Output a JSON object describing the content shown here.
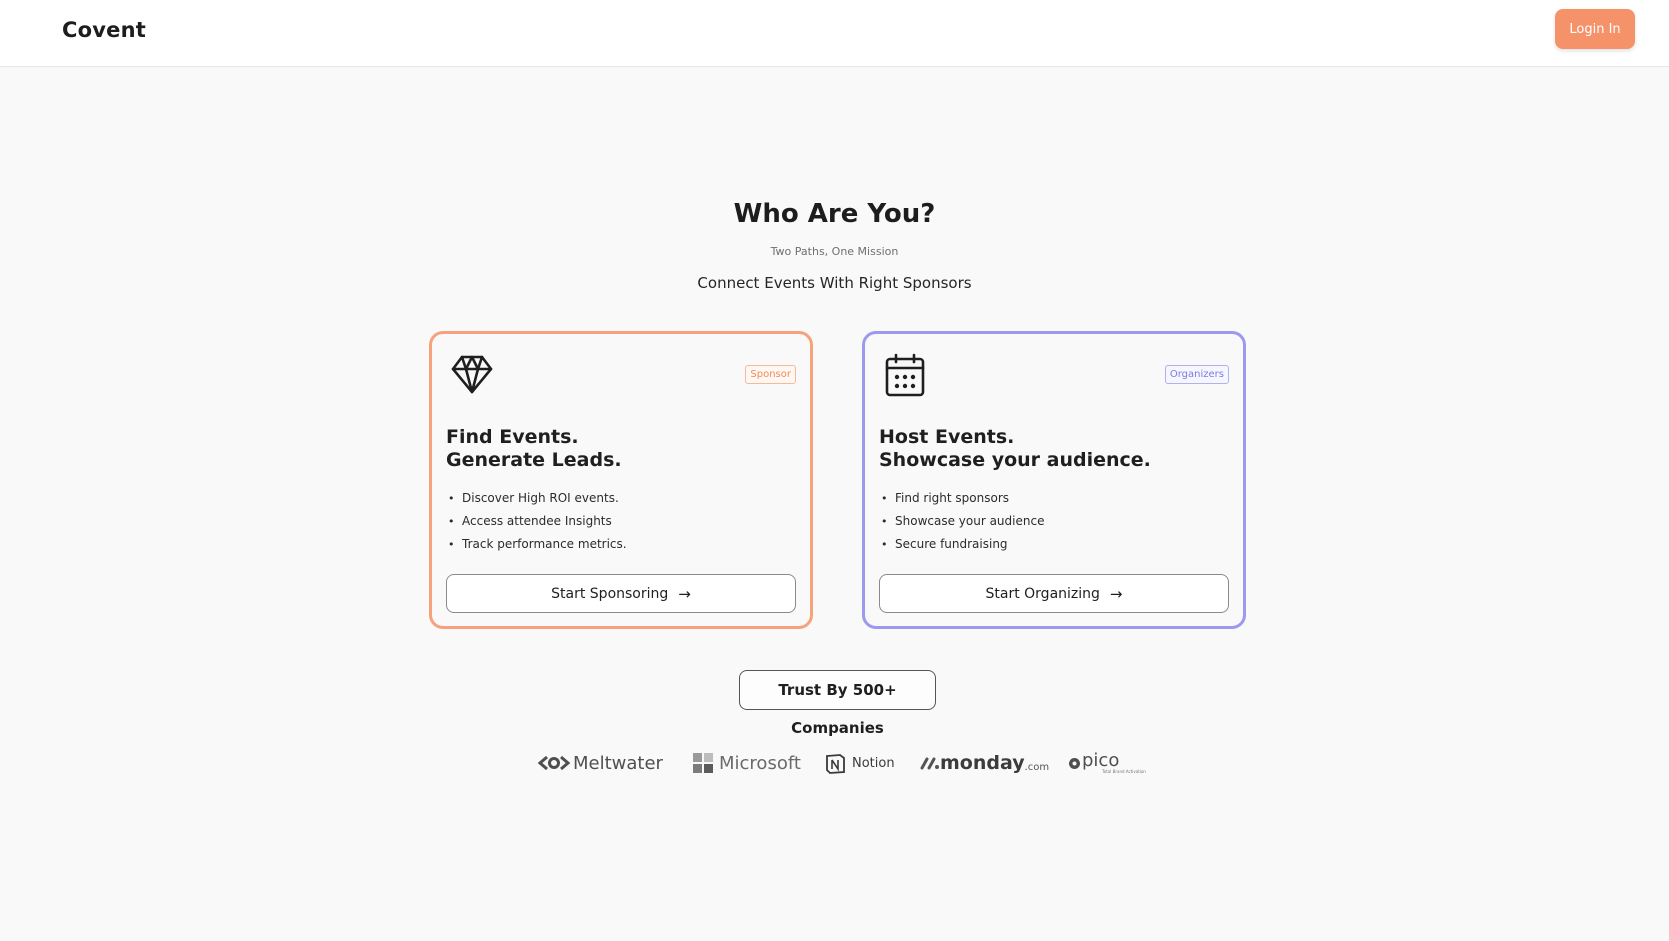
{
  "header": {
    "logo": "Covent",
    "login_label": "Login In"
  },
  "hero": {
    "title": "Who Are You?",
    "subtitle": "Two Paths, One Mission",
    "tagline": "Connect Events With Right Sponsors"
  },
  "cards": [
    {
      "badge": "Sponsor",
      "icon": "diamond-icon",
      "title_line1": "Find Events.",
      "title_line2": "Generate Leads.",
      "bullets": [
        "Discover High ROI events.",
        "Access attendee Insights",
        "Track performance metrics."
      ],
      "button": "Start Sponsoring",
      "accent": "#f5a27d"
    },
    {
      "badge": "Organizers",
      "icon": "calendar-icon",
      "title_line1": "Host Events.",
      "title_line2": "Showcase your audience.",
      "bullets": [
        "Find right sponsors",
        "Showcase your audience",
        "Secure fundraising"
      ],
      "button": "Start Organizing",
      "accent": "#9c99ee"
    }
  ],
  "trust": {
    "label": "Trust By 500+ Companies"
  },
  "companies": [
    {
      "name": "Meltwater",
      "icon": "meltwater-logo"
    },
    {
      "name": "Microsoft",
      "icon": "microsoft-logo"
    },
    {
      "name": "Notion",
      "icon": "notion-logo"
    },
    {
      "name": "monday",
      "suffix": ".com",
      "icon": "monday-logo"
    },
    {
      "name": "pico",
      "tagline": "Total Brand Activation",
      "icon": "pico-logo"
    }
  ],
  "colors": {
    "accent_orange": "#f5926a",
    "accent_purple": "#9c99ee",
    "background": "#f9f9f9"
  }
}
